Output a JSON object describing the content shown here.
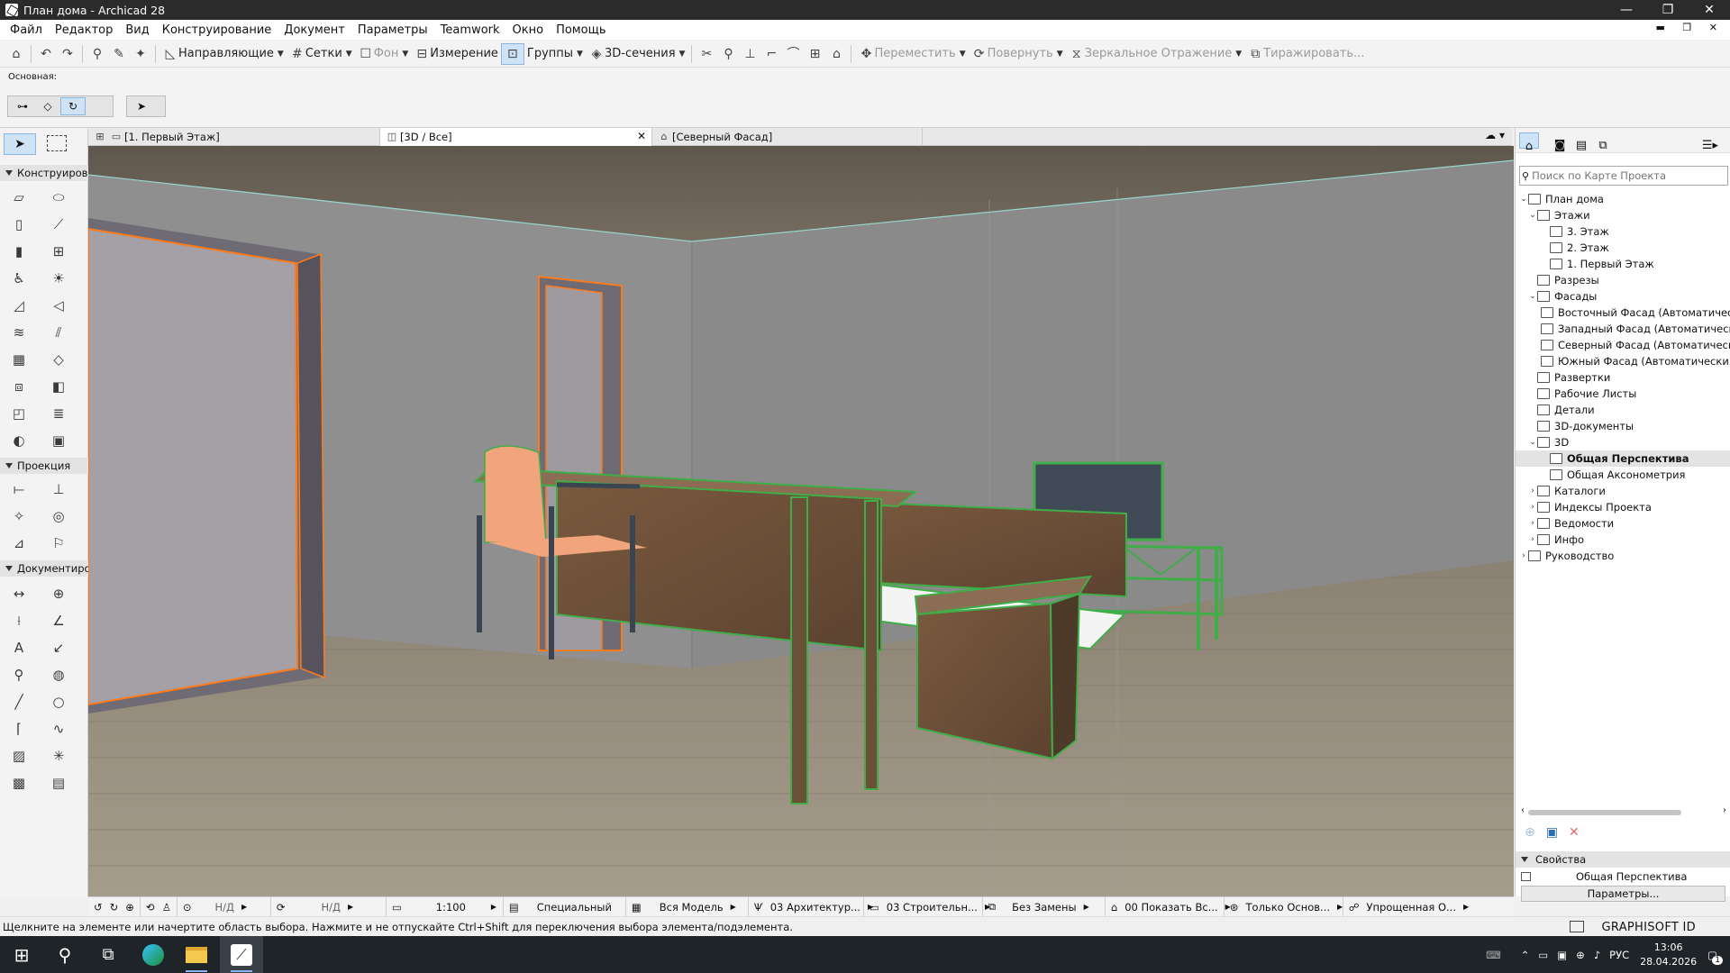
{
  "app": {
    "window_title": "План дома - Archicad 28"
  },
  "menu": [
    "Файл",
    "Редактор",
    "Вид",
    "Конструирование",
    "Документ",
    "Параметры",
    "Teamwork",
    "Окно",
    "Помощь"
  ],
  "toolbar": {
    "guides": "Направляющие",
    "grids": "Сетки",
    "background": "Фон",
    "measure": "Измерение",
    "groups": "Группы",
    "sections3d": "3D-сечения",
    "move": "Переместить",
    "rotate": "Повернуть",
    "mirror": "Зеркальное Отражение",
    "multiply": "Тиражировать..."
  },
  "infobar": {
    "label": "Основная:"
  },
  "tabs": [
    {
      "label": "[1. Первый Этаж]"
    },
    {
      "label": "[3D / Все]"
    },
    {
      "label": "[Северный Фасад]"
    }
  ],
  "toolbox": {
    "sections": [
      "Конструиров",
      "Проекция",
      "Документиро"
    ]
  },
  "navigator": {
    "search_placeholder": "Поиск по Карте Проекта",
    "tree": [
      "План дома",
      "Этажи",
      "3. Этаж",
      "2. Этаж",
      "1. Первый Этаж",
      "Разрезы",
      "Фасады",
      "Восточный Фасад (Автоматическ",
      "Западный Фасад (Автоматически",
      "Северный Фасад (Автоматически",
      "Южный Фасад (Автоматически П",
      "Развертки",
      "Рабочие Листы",
      "Детали",
      "3D-документы",
      "3D",
      "Общая Перспектива",
      "Общая Аксонометрия",
      "Каталоги",
      "Индексы Проекта",
      "Ведомости",
      "Инфо",
      "Руководство"
    ],
    "properties_header": "Свойства",
    "properties_value": "Общая Перспектива",
    "params_button": "Параметры..."
  },
  "statusbar": {
    "nd1": "Н/Д",
    "nd2": "Н/Д",
    "scale": "1:100",
    "penset": "Специальный",
    "model": "Вся Модель",
    "layer": "03 Архитектур...",
    "struct": "03 Строительн...",
    "override": "Без Замены",
    "renov": "00 Показать Вс...",
    "struct_only": "Только Основ...",
    "simplified": "Упрощенная О..."
  },
  "hint": "Щелкните на элементе или начертите область выбора. Нажмите и не отпускайте Ctrl+Shift для переключения выбора элемента/подэлемента.",
  "graphisoft": "GRAPHISOFT ID",
  "taskbar": {
    "lang": "РУС",
    "time": "13:06",
    "date": "28.04.2026",
    "notif": "1"
  },
  "colors": {
    "selection_green": "#3fae49",
    "door_orange": "#ff7a1a",
    "accent": "#8ab4f8"
  }
}
